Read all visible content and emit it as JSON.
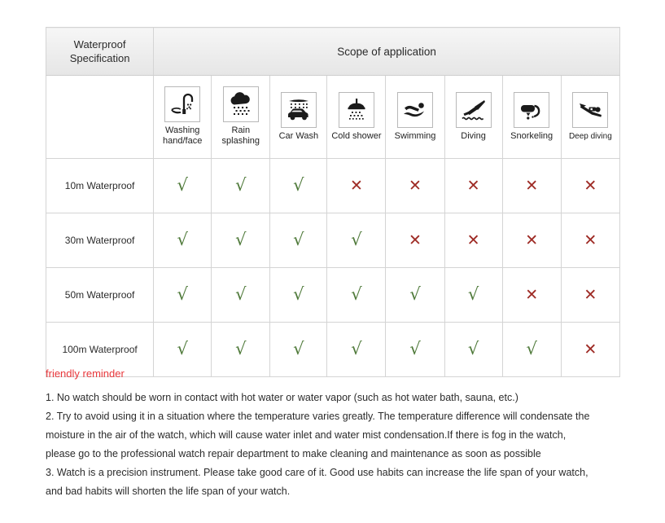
{
  "table": {
    "header": {
      "spec_label": "Waterproof\nSpecification",
      "spec_label_line1": "Waterproof",
      "spec_label_line2": "Specification",
      "scope_label": "Scope of application"
    },
    "columns": [
      {
        "icon": "faucet-hand-washing-icon",
        "label_line1": "Washing",
        "label_line2": "hand/face"
      },
      {
        "icon": "rain-cloud-icon",
        "label_line1": "Rain",
        "label_line2": "splashing"
      },
      {
        "icon": "car-wash-icon",
        "label_line1": "Car Wash",
        "label_line2": ""
      },
      {
        "icon": "shower-head-icon",
        "label_line1": "Cold shower",
        "label_line2": ""
      },
      {
        "icon": "swimmer-icon",
        "label_line1": "Swimming",
        "label_line2": ""
      },
      {
        "icon": "springboard-diver-icon",
        "label_line1": "Diving",
        "label_line2": ""
      },
      {
        "icon": "snorkel-mask-icon",
        "label_line1": "Snorkeling",
        "label_line2": ""
      },
      {
        "icon": "scuba-diver-icon",
        "label_line1": "Deep diving",
        "label_line2": ""
      }
    ],
    "rows": [
      {
        "label": "10m Waterproof",
        "cells": [
          "yes",
          "yes",
          "yes",
          "no",
          "no",
          "no",
          "no",
          "no"
        ]
      },
      {
        "label": "30m Waterproof",
        "cells": [
          "yes",
          "yes",
          "yes",
          "yes",
          "no",
          "no",
          "no",
          "no"
        ]
      },
      {
        "label": "50m Waterproof",
        "cells": [
          "yes",
          "yes",
          "yes",
          "yes",
          "yes",
          "yes",
          "no",
          "no"
        ]
      },
      {
        "label": "100m Waterproof",
        "cells": [
          "yes",
          "yes",
          "yes",
          "yes",
          "yes",
          "yes",
          "yes",
          "no"
        ]
      }
    ],
    "marks": {
      "yes_glyph": "√",
      "no_glyph": "✕",
      "yes_color": "#4f7a3a",
      "no_color": "#9e2b25"
    }
  },
  "notes": {
    "title": "friendly reminder",
    "title_color": "#e8373b",
    "lines": [
      "1. No watch should be worn in contact with hot water or water vapor (such as hot water bath, sauna, etc.)",
      "2. Try to avoid using it in a situation where the temperature varies greatly. The temperature difference will condensate the",
      "moisture in the air of the watch, which will cause water inlet and water mist condensation.If there is fog in the watch,",
      "please go to the professional watch repair department to make cleaning and maintenance as soon as possible",
      "3. Watch is a precision instrument. Please take good care of it. Good use habits can increase the life span of your watch,",
      "and bad habits will shorten the life span of your watch."
    ]
  }
}
